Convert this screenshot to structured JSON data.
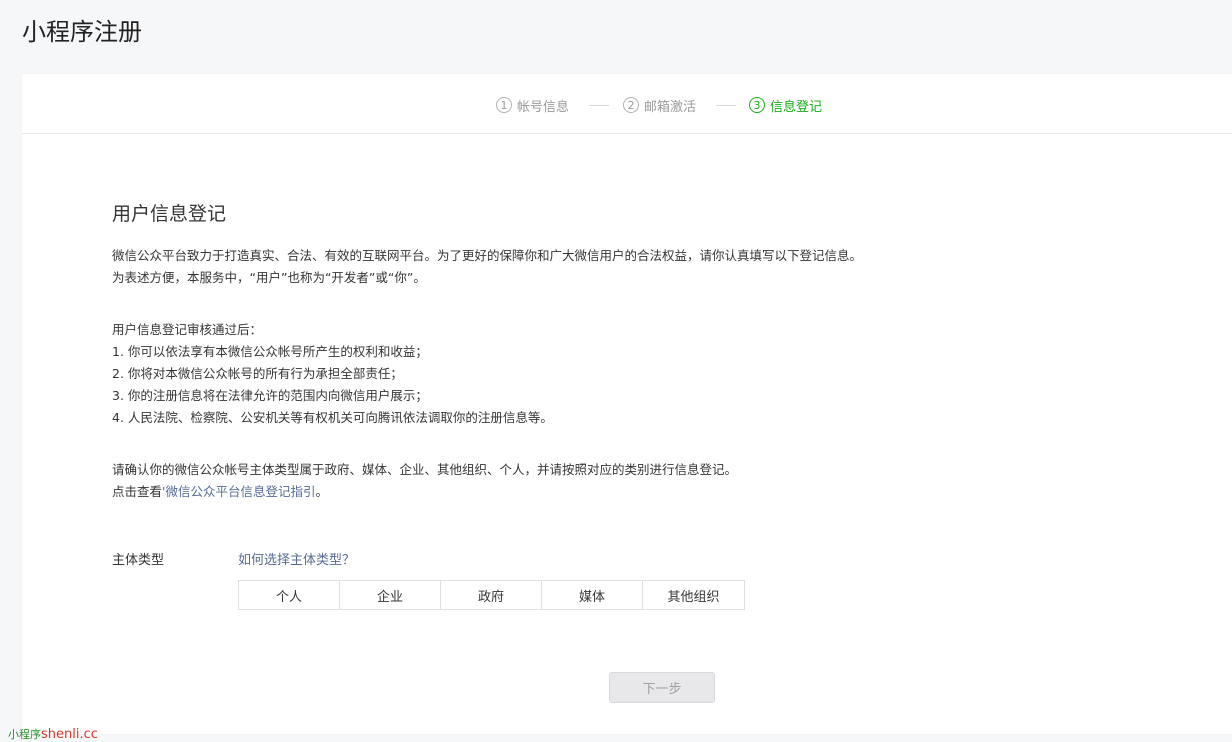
{
  "page": {
    "title": "小程序注册"
  },
  "steps": [
    {
      "number": "1",
      "label": "帐号信息"
    },
    {
      "number": "2",
      "label": "邮箱激活"
    },
    {
      "number": "3",
      "label": "信息登记"
    }
  ],
  "section": {
    "title": "用户信息登记"
  },
  "intro": {
    "line1": "微信公众平台致力于打造真实、合法、有效的互联网平台。为了更好的保障你和广大微信用户的合法权益，请你认真填写以下登记信息。",
    "line2": "为表述方便，本服务中，“用户”也称为“开发者”或“你”。"
  },
  "rights": {
    "heading": "用户信息登记审核通过后：",
    "items": [
      "1. 你可以依法享有本微信公众帐号所产生的权利和收益；",
      "2. 你将对本微信公众帐号的所有行为承担全部责任；",
      "3. 你的注册信息将在法律允许的范围内向微信用户展示；",
      "4. 人民法院、检察院、公安机关等有权机关可向腾讯依法调取你的注册信息等。"
    ]
  },
  "confirm": {
    "line1": "请确认你的微信公众帐号主体类型属于政府、媒体、企业、其他组织、个人，并请按照对应的类别进行信息登记。",
    "guide_prefix": "点击查看",
    "guide_link": "'微信公众平台信息登记指引",
    "guide_suffix": "。"
  },
  "subject_type": {
    "label": "主体类型",
    "help_link": "如何选择主体类型？",
    "options": [
      "个人",
      "企业",
      "政府",
      "媒体",
      "其他组织"
    ]
  },
  "next_button": {
    "label": "下一步"
  },
  "watermark": {
    "part1": "小程序",
    "part2": "shenli.cc"
  },
  "colors": {
    "accent_green": "#1aad19",
    "link_blue": "#576b95",
    "disabled_gray": "#a0a0a0"
  }
}
